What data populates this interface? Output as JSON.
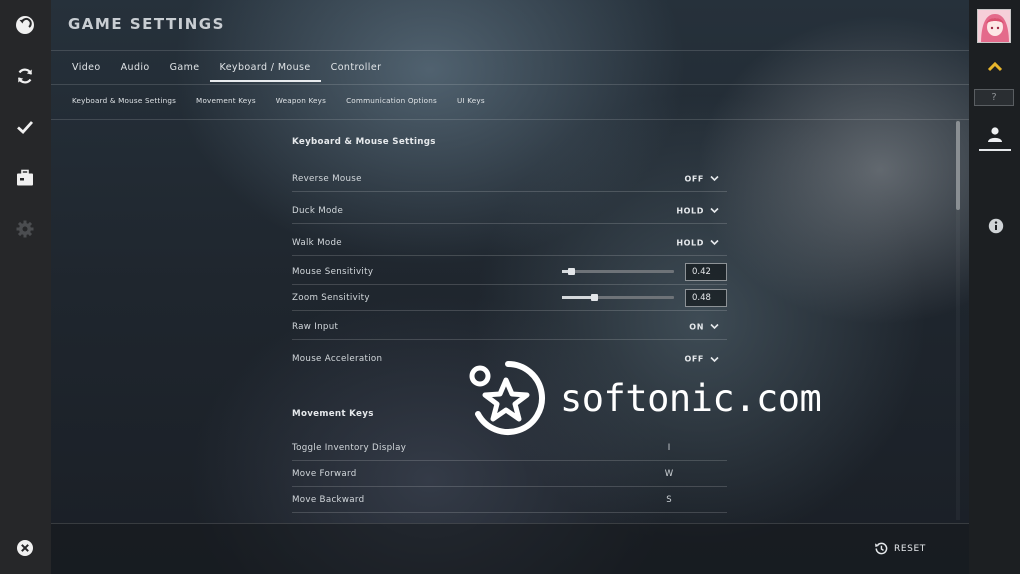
{
  "header": {
    "title": "GAME SETTINGS"
  },
  "main_tabs": [
    {
      "label": "Video"
    },
    {
      "label": "Audio"
    },
    {
      "label": "Game"
    },
    {
      "label": "Keyboard / Mouse",
      "active": true
    },
    {
      "label": "Controller"
    }
  ],
  "sub_tabs": [
    {
      "label": "Keyboard & Mouse Settings"
    },
    {
      "label": "Movement Keys"
    },
    {
      "label": "Weapon Keys"
    },
    {
      "label": "Communication Options"
    },
    {
      "label": "UI Keys"
    }
  ],
  "keyboard_mouse": {
    "title": "Keyboard & Mouse Settings",
    "reverse_mouse": {
      "label": "Reverse Mouse",
      "value": "OFF"
    },
    "duck_mode": {
      "label": "Duck Mode",
      "value": "HOLD"
    },
    "walk_mode": {
      "label": "Walk Mode",
      "value": "HOLD"
    },
    "mouse_sensitivity": {
      "label": "Mouse Sensitivity",
      "value": "0.42",
      "slider_fraction": 0.08
    },
    "zoom_sensitivity": {
      "label": "Zoom Sensitivity",
      "value": "0.48",
      "slider_fraction": 0.29
    },
    "raw_input": {
      "label": "Raw Input",
      "value": "ON"
    },
    "mouse_acceleration": {
      "label": "Mouse Acceleration",
      "value": "OFF"
    }
  },
  "movement_keys": {
    "title": "Movement Keys",
    "rows": [
      {
        "label": "Toggle Inventory Display",
        "key": "I"
      },
      {
        "label": "Move Forward",
        "key": "W"
      },
      {
        "label": "Move Backward",
        "key": "S"
      }
    ]
  },
  "footer": {
    "reset_label": "RESET"
  },
  "watermark": {
    "text": "softonic.com"
  },
  "right_bar": {
    "help_label": "?"
  },
  "icons": {
    "left": [
      "back-arrow-icon",
      "refresh-icon",
      "checkmark-icon",
      "briefcase-icon",
      "gear-icon",
      "close-icon"
    ],
    "right": [
      "chevron-up-icon",
      "help-icon",
      "user-icon",
      "info-icon",
      "history-icon"
    ]
  },
  "colors": {
    "rank_chevron": "#e7b52c",
    "panel_dark": "#262729"
  }
}
